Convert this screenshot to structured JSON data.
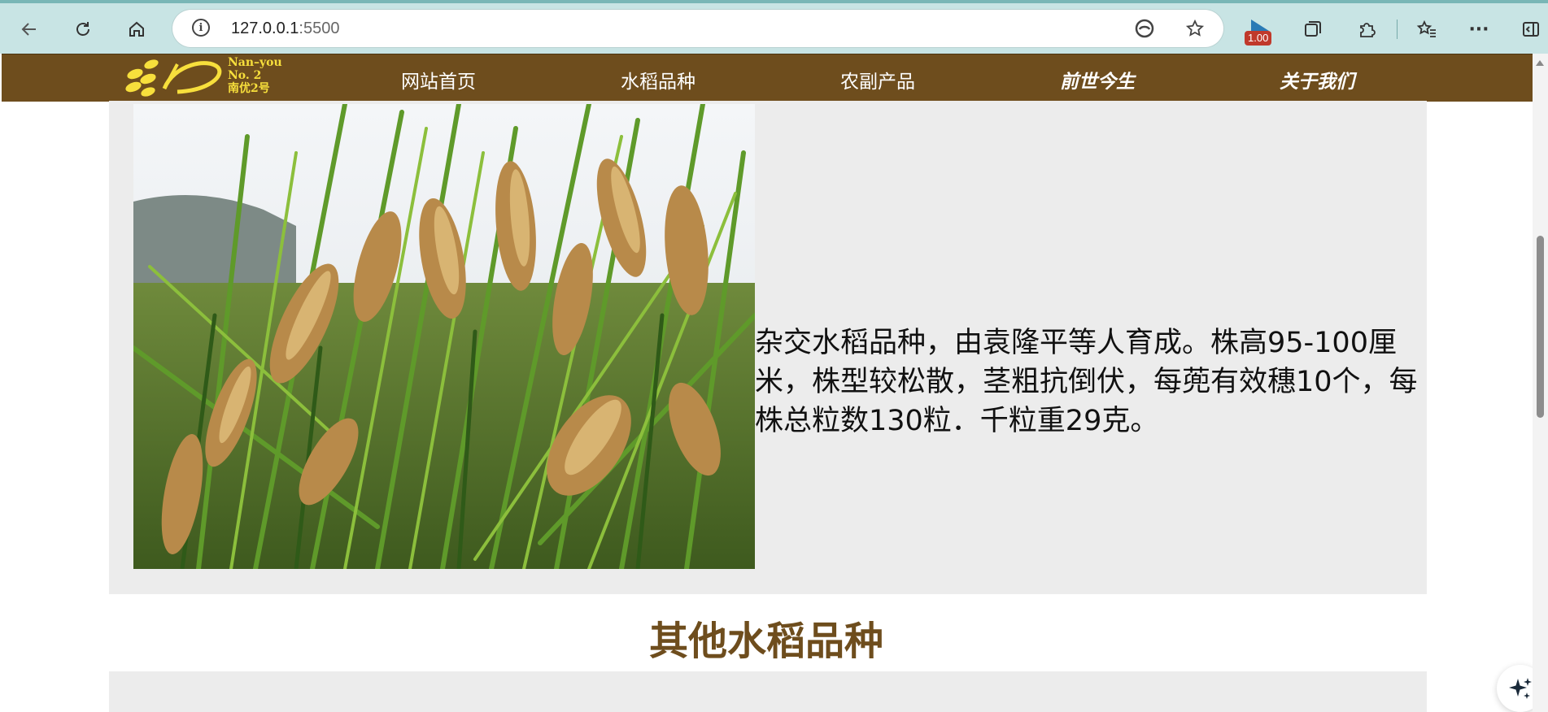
{
  "browser": {
    "url_host": "127.0.0.1",
    "url_port": ":5500",
    "extension_badge": "1.00",
    "icons": {
      "back": "arrow-left-icon",
      "reload": "reload-icon",
      "home": "home-icon",
      "info": "info-icon",
      "read_aloud": "edge-icon",
      "favorite": "star-icon",
      "extension_flag": "flag-icon",
      "collections": "collections-icon",
      "extensions": "puzzle-icon",
      "favorites_bar": "favorites-icon",
      "more": "more-icon",
      "sidebar": "sidebar-icon"
    },
    "info_glyph": "i",
    "more_glyph": "···"
  },
  "site": {
    "logo": {
      "line1": "Nan–you",
      "line2": "No. 2",
      "line3": "南优2号"
    },
    "nav": [
      {
        "label": "网站首页"
      },
      {
        "label": "水稻品种"
      },
      {
        "label": "农副产品"
      },
      {
        "label": "前世今生"
      },
      {
        "label": "关于我们"
      }
    ],
    "colors": {
      "nav_bg": "#6e4d1d",
      "logo_yellow": "#f7df3c",
      "panel_bg": "#ececec",
      "title_color": "#6e4d1d"
    }
  },
  "main": {
    "description": "杂交水稻品种，由袁隆平等人育成。株高95-100厘米，株型较松散，茎粗抗倒伏，每蔸有效穗10个，每株总粒数130粒．千粒重29克。",
    "section_title": "其他水稻品种"
  }
}
